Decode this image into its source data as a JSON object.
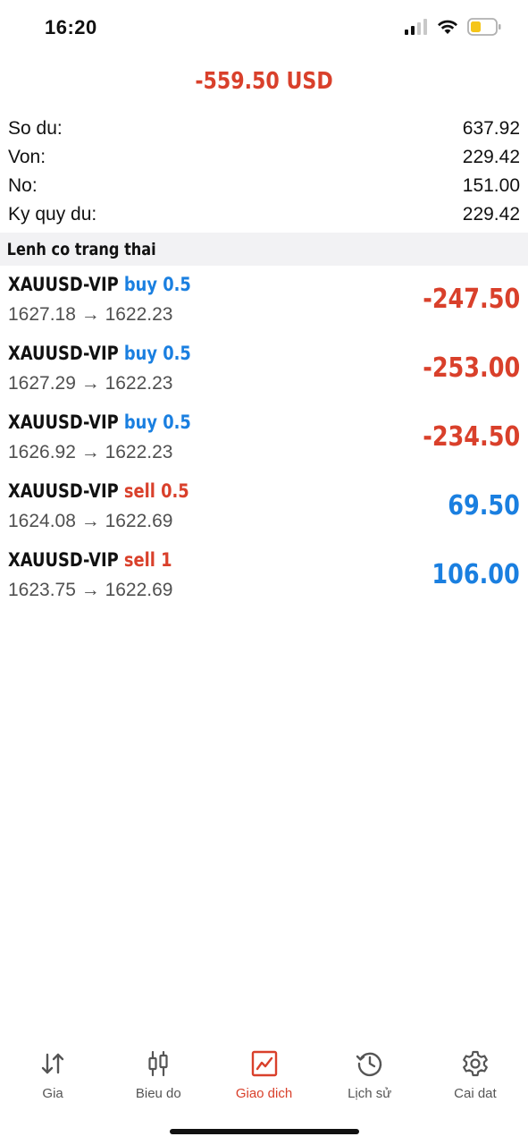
{
  "status_bar": {
    "time": "16:20"
  },
  "account": {
    "total_profit": "-559.50 USD",
    "rows": [
      {
        "label": "So du:",
        "value": "637.92"
      },
      {
        "label": "Von:",
        "value": "229.42"
      },
      {
        "label": "No:",
        "value": "151.00"
      },
      {
        "label": "Ky quy du:",
        "value": "229.42"
      }
    ]
  },
  "section_title": "Lenh co trang thai",
  "orders": [
    {
      "symbol": "XAUUSD-VIP",
      "side": "buy 0.5",
      "prices": "1627.18 → 1622.23",
      "profit": "-247.50"
    },
    {
      "symbol": "XAUUSD-VIP",
      "side": "buy 0.5",
      "prices": "1627.29 → 1622.23",
      "profit": "-253.00"
    },
    {
      "symbol": "XAUUSD-VIP",
      "side": "buy 0.5",
      "prices": "1626.92 → 1622.23",
      "profit": "-234.50"
    },
    {
      "symbol": "XAUUSD-VIP",
      "side": "sell 0.5",
      "prices": "1624.08 → 1622.69",
      "profit": "69.50"
    },
    {
      "symbol": "XAUUSD-VIP",
      "side": "sell 1",
      "prices": "1623.75 → 1622.69",
      "profit": "106.00"
    }
  ],
  "tabs": [
    {
      "label": "Gia",
      "icon": "sort-arrows-icon"
    },
    {
      "label": "Bieu do",
      "icon": "candlestick-icon"
    },
    {
      "label": "Giao dich",
      "icon": "trade-chart-icon",
      "active": true
    },
    {
      "label": "Lịch sử",
      "icon": "history-icon"
    },
    {
      "label": "Cai dat",
      "icon": "gear-icon"
    }
  ],
  "colors": {
    "negative": "#d9402b",
    "positive": "#1a7fe0",
    "active_tab": "#d9402b",
    "section_bg": "#f2f2f4"
  }
}
